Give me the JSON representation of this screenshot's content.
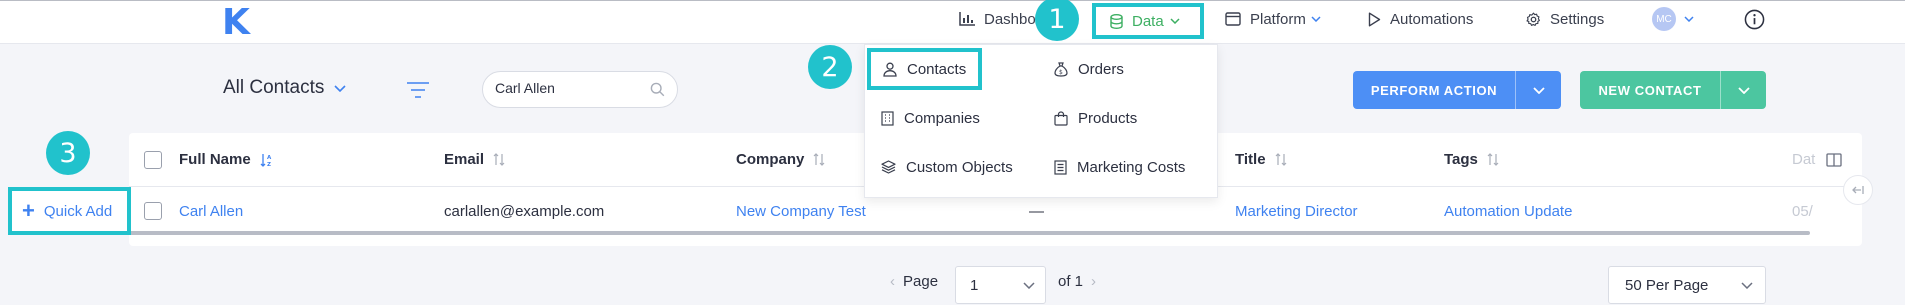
{
  "app": {
    "logo": "K"
  },
  "nav": {
    "dashboard": "Dashboard",
    "data": "Data",
    "platform": "Platform",
    "automations": "Automations",
    "settings": "Settings",
    "avatar_initials": "MC"
  },
  "steps": [
    "1",
    "2",
    "3"
  ],
  "view": {
    "title": "All Contacts",
    "search_value": "Carl Allen"
  },
  "actions": {
    "perform": "PERFORM ACTION",
    "new_contact": "NEW CONTACT",
    "quick_add": "Quick Add"
  },
  "data_menu": {
    "contacts": "Contacts",
    "orders": "Orders",
    "companies": "Companies",
    "products": "Products",
    "custom_objects": "Custom Objects",
    "marketing_costs": "Marketing Costs"
  },
  "table": {
    "columns": {
      "full_name": "Full Name",
      "email": "Email",
      "company": "Company",
      "title": "Title",
      "tags": "Tags",
      "date": "Dat"
    },
    "rows": [
      {
        "full_name": "Carl Allen",
        "email": "carlallen@example.com",
        "company": "New Company Test",
        "phone": "—",
        "title": "Marketing Director",
        "tags": "Automation Update",
        "date": "05/"
      }
    ]
  },
  "pagination": {
    "page_label": "Page",
    "current_page": "1",
    "of_label": "of 1",
    "per_page": "50 Per Page"
  },
  "colors": {
    "accent_blue": "#3f82f0",
    "highlight_teal": "#21c2cc",
    "perform_button": "#4d8ff5",
    "new_contact_button": "#4cc6a0",
    "data_nav_green": "#3daf62"
  }
}
